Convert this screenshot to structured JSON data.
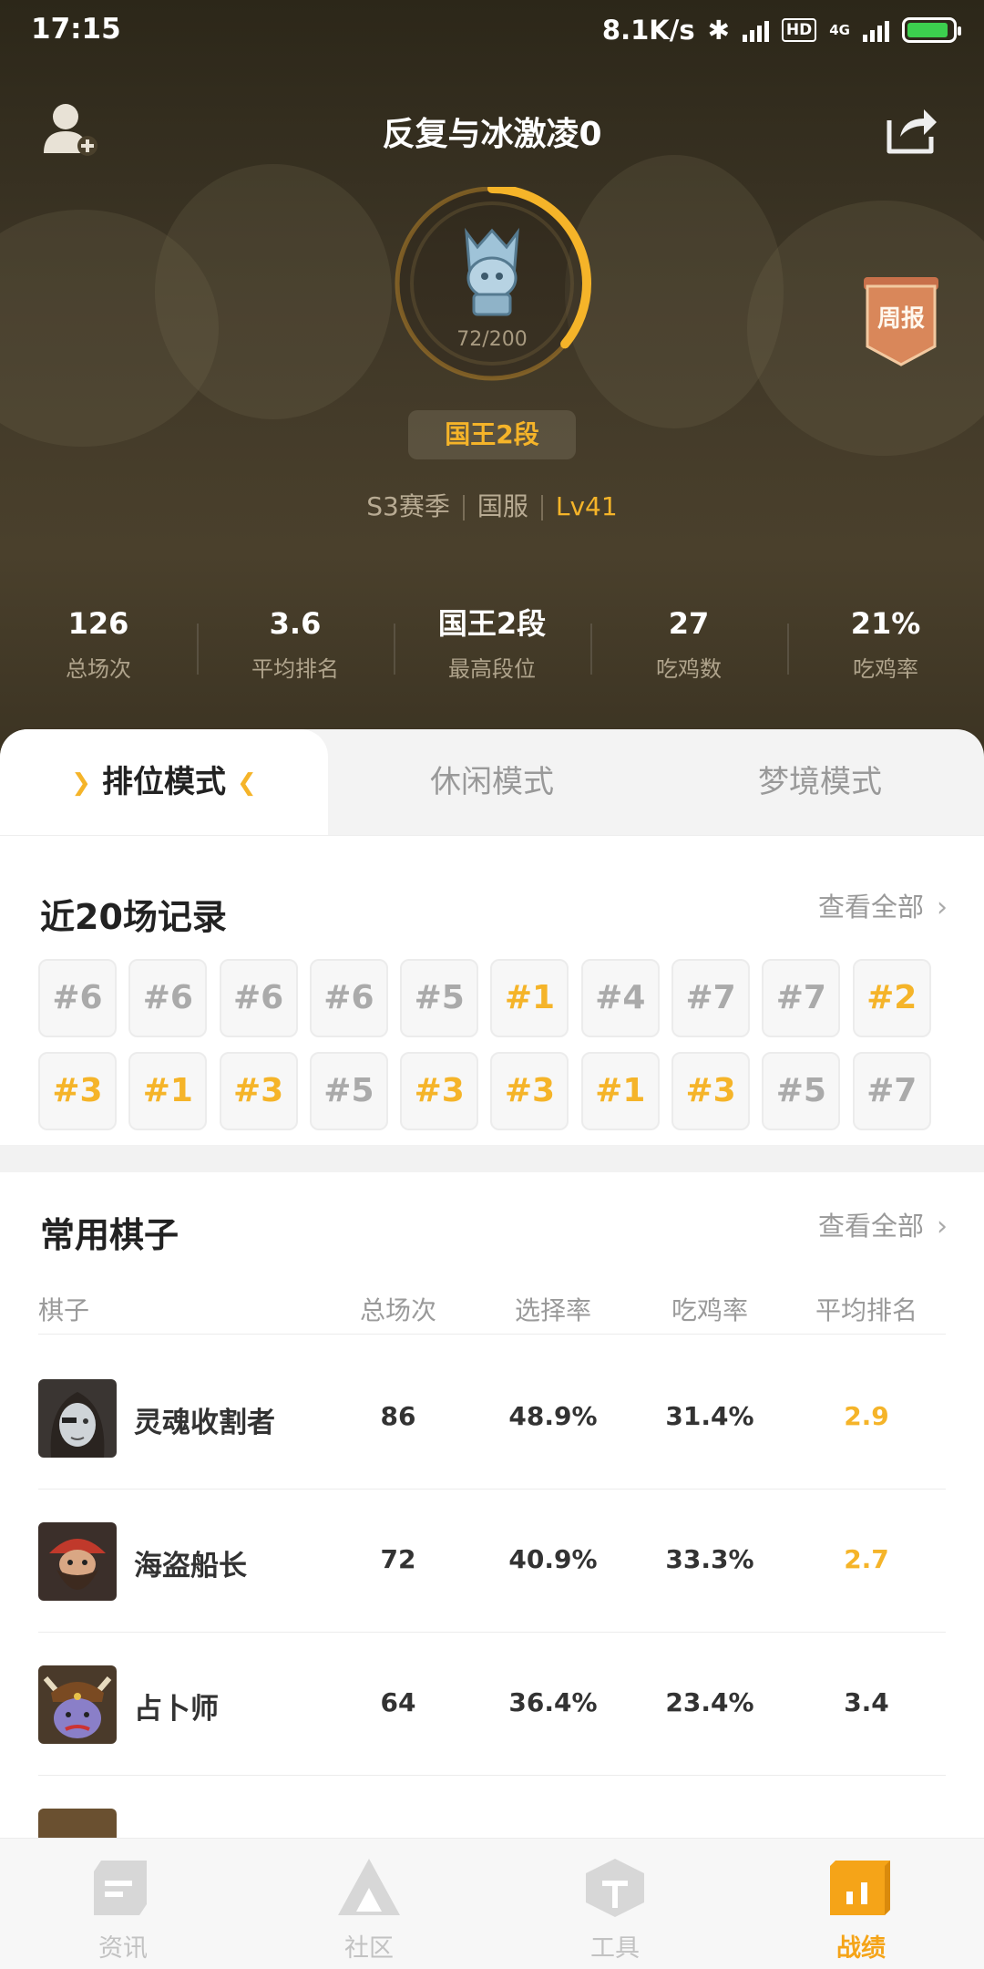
{
  "status_bar": {
    "time": "17:15",
    "network_speed": "8.1K/s",
    "hd": "HD",
    "network_type": "4G"
  },
  "header": {
    "player_name": "反复与冰激凌0"
  },
  "rank": {
    "progress_text": "72/200",
    "progress_value": 72,
    "progress_max": 200,
    "title": "国王2段"
  },
  "meta": {
    "season": "S3赛季",
    "server": "国服",
    "level": "Lv41"
  },
  "weekly_report": "周报",
  "stats": [
    {
      "value": "126",
      "label": "总场次"
    },
    {
      "value": "3.6",
      "label": "平均排名"
    },
    {
      "value": "国王2段",
      "label": "最高段位"
    },
    {
      "value": "27",
      "label": "吃鸡数"
    },
    {
      "value": "21%",
      "label": "吃鸡率"
    }
  ],
  "tabs": [
    "排位模式",
    "休闲模式",
    "梦境模式"
  ],
  "recent": {
    "title": "近20场记录",
    "view_all": "查看全部",
    "results": [
      "#6",
      "#6",
      "#6",
      "#6",
      "#5",
      "#1",
      "#4",
      "#7",
      "#7",
      "#2",
      "#3",
      "#1",
      "#3",
      "#5",
      "#3",
      "#3",
      "#1",
      "#3",
      "#5",
      "#7"
    ]
  },
  "chess": {
    "title": "常用棋子",
    "view_all": "查看全部",
    "headers": [
      "棋子",
      "总场次",
      "选择率",
      "吃鸡率",
      "平均排名"
    ],
    "rows": [
      {
        "name": "灵魂收割者",
        "games": "86",
        "pick_rate": "48.9%",
        "win_rate": "31.4%",
        "avg_rank": "2.9"
      },
      {
        "name": "海盗船长",
        "games": "72",
        "pick_rate": "40.9%",
        "win_rate": "33.3%",
        "avg_rank": "2.7"
      },
      {
        "name": "占卜师",
        "games": "64",
        "pick_rate": "36.4%",
        "win_rate": "23.4%",
        "avg_rank": "3.4"
      }
    ]
  },
  "nav": [
    {
      "label": "资讯",
      "icon": "news-icon"
    },
    {
      "label": "社区",
      "icon": "community-icon"
    },
    {
      "label": "工具",
      "icon": "tools-icon"
    },
    {
      "label": "战绩",
      "icon": "stats-icon"
    }
  ],
  "colors": {
    "accent": "#f5b429",
    "nav_active": "#f5a418"
  }
}
